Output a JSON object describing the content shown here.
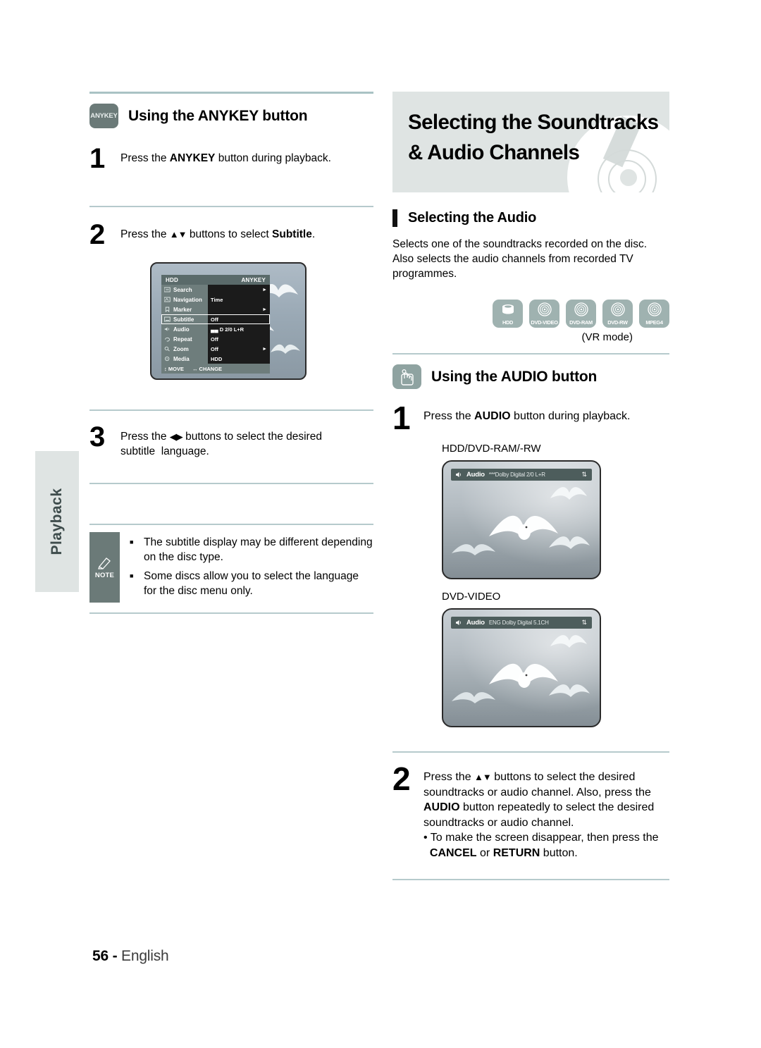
{
  "page": {
    "footer_number": "56",
    "footer_sep": "-",
    "footer_language": "English",
    "side_tab_label": "Playback"
  },
  "left_column": {
    "section": {
      "icon_name": "anykey-button-icon",
      "icon_label": "ANYKEY",
      "heading": "Using the ANYKEY button"
    },
    "steps": [
      {
        "number": "1",
        "text_parts": [
          {
            "t": "Press the ",
            "bold": false
          },
          {
            "t": "ANYKEY",
            "bold": true
          },
          {
            "t": " button during playback.",
            "bold": false
          }
        ],
        "plain": "Press the ANYKEY button during playback."
      },
      {
        "number": "2",
        "plain": "Press the ▲▼ buttons to select Subtitle."
      },
      {
        "number": "3",
        "plain": "Press the ◀▶ buttons to select the desired subtitle  language."
      }
    ],
    "osd_menu": {
      "title_left": "HDD",
      "title_right": "ANYKEY",
      "rows": [
        {
          "icon": "search-icon",
          "label": "Search",
          "value": "",
          "caret": true
        },
        {
          "icon": "navigation-icon",
          "label": "Navigation",
          "value": "Time",
          "caret": false
        },
        {
          "icon": "marker-icon",
          "label": "Marker",
          "value": "",
          "caret": true
        },
        {
          "icon": "subtitle-icon",
          "label": "Subtitle",
          "value": "Off",
          "caret": false,
          "selected": true
        },
        {
          "icon": "audio-icon",
          "label": "Audio",
          "value": "▄▄ D 2/0 L+R",
          "caret": false
        },
        {
          "icon": "repeat-icon",
          "label": "Repeat",
          "value": "Off",
          "caret": false
        },
        {
          "icon": "zoom-icon",
          "label": "Zoom",
          "value": "Off",
          "caret": true
        },
        {
          "icon": "media-icon",
          "label": "Media",
          "value": "HDD",
          "caret": false
        }
      ],
      "footer_move": "MOVE",
      "footer_change": "CHANGE",
      "footer_move_glyph": "↕",
      "footer_change_glyph": "↔"
    },
    "note": {
      "icon_name": "pencil-note-icon",
      "label": "NOTE",
      "items": [
        "The subtitle display may be different depending on the disc type.",
        "Some discs allow you to select the language for the disc menu only."
      ]
    }
  },
  "right_column": {
    "banner": {
      "title_line1": "Selecting the Soundtracks",
      "title_line2": "& Audio Channels",
      "background": "#dfe4e3",
      "art": "dvd-disc-graphic"
    },
    "subsection": {
      "heading": "Selecting the Audio",
      "body": "Selects one of the soundtracks recorded on the disc. Also selects the audio channels from recorded TV programmes."
    },
    "disc_icons": [
      {
        "name": "HDD",
        "glyph": "hdd-stack-icon"
      },
      {
        "name": "DVD-VIDEO",
        "glyph": "disc-icon"
      },
      {
        "name": "DVD-RAM",
        "glyph": "disc-icon"
      },
      {
        "name": "DVD-RW",
        "glyph": "disc-icon"
      },
      {
        "name": "MPEG4",
        "glyph": "disc-icon"
      }
    ],
    "disc_icons_note": "(VR mode)",
    "section": {
      "icon_name": "audio-button-press-icon",
      "heading": "Using the AUDIO button"
    },
    "steps": [
      {
        "number": "1",
        "plain": "Press the AUDIO button during playback."
      },
      {
        "number": "2",
        "line1": "Press the ▲▼ buttons to select the desired",
        "line2": "soundtracks or audio channel. Also, press the",
        "line3_bold": "AUDIO",
        "line3_rest": " button repeatedly to select the desired",
        "line4": "soundtracks or audio channel.",
        "bullet_line1": "• To make the screen disappear, then press the",
        "bullet_line2_bold1": "CANCEL",
        "bullet_line2_mid": " or ",
        "bullet_line2_bold2": "RETURN",
        "bullet_line2_rest": " button."
      }
    ],
    "tv_screens": [
      {
        "label": "HDD/DVD-RAM/-RW",
        "osd": {
          "speaker_icon": "speaker-icon",
          "word": "Audio",
          "value": "***Dolby Digital   2/0 L+R",
          "updown_icon": "⇅"
        }
      },
      {
        "label": "DVD-VIDEO",
        "osd": {
          "speaker_icon": "speaker-icon",
          "word": "Audio",
          "value": "ENG  Dolby Digital   5.1CH",
          "updown_icon": "⇅"
        }
      }
    ]
  },
  "colors": {
    "banner_bg": "#dfe4e3",
    "rule": "#a9c2c4",
    "icon_dark": "#6b7a78",
    "icon_light": "#9fb2b0",
    "osd_bar": "#4d5d5c"
  }
}
